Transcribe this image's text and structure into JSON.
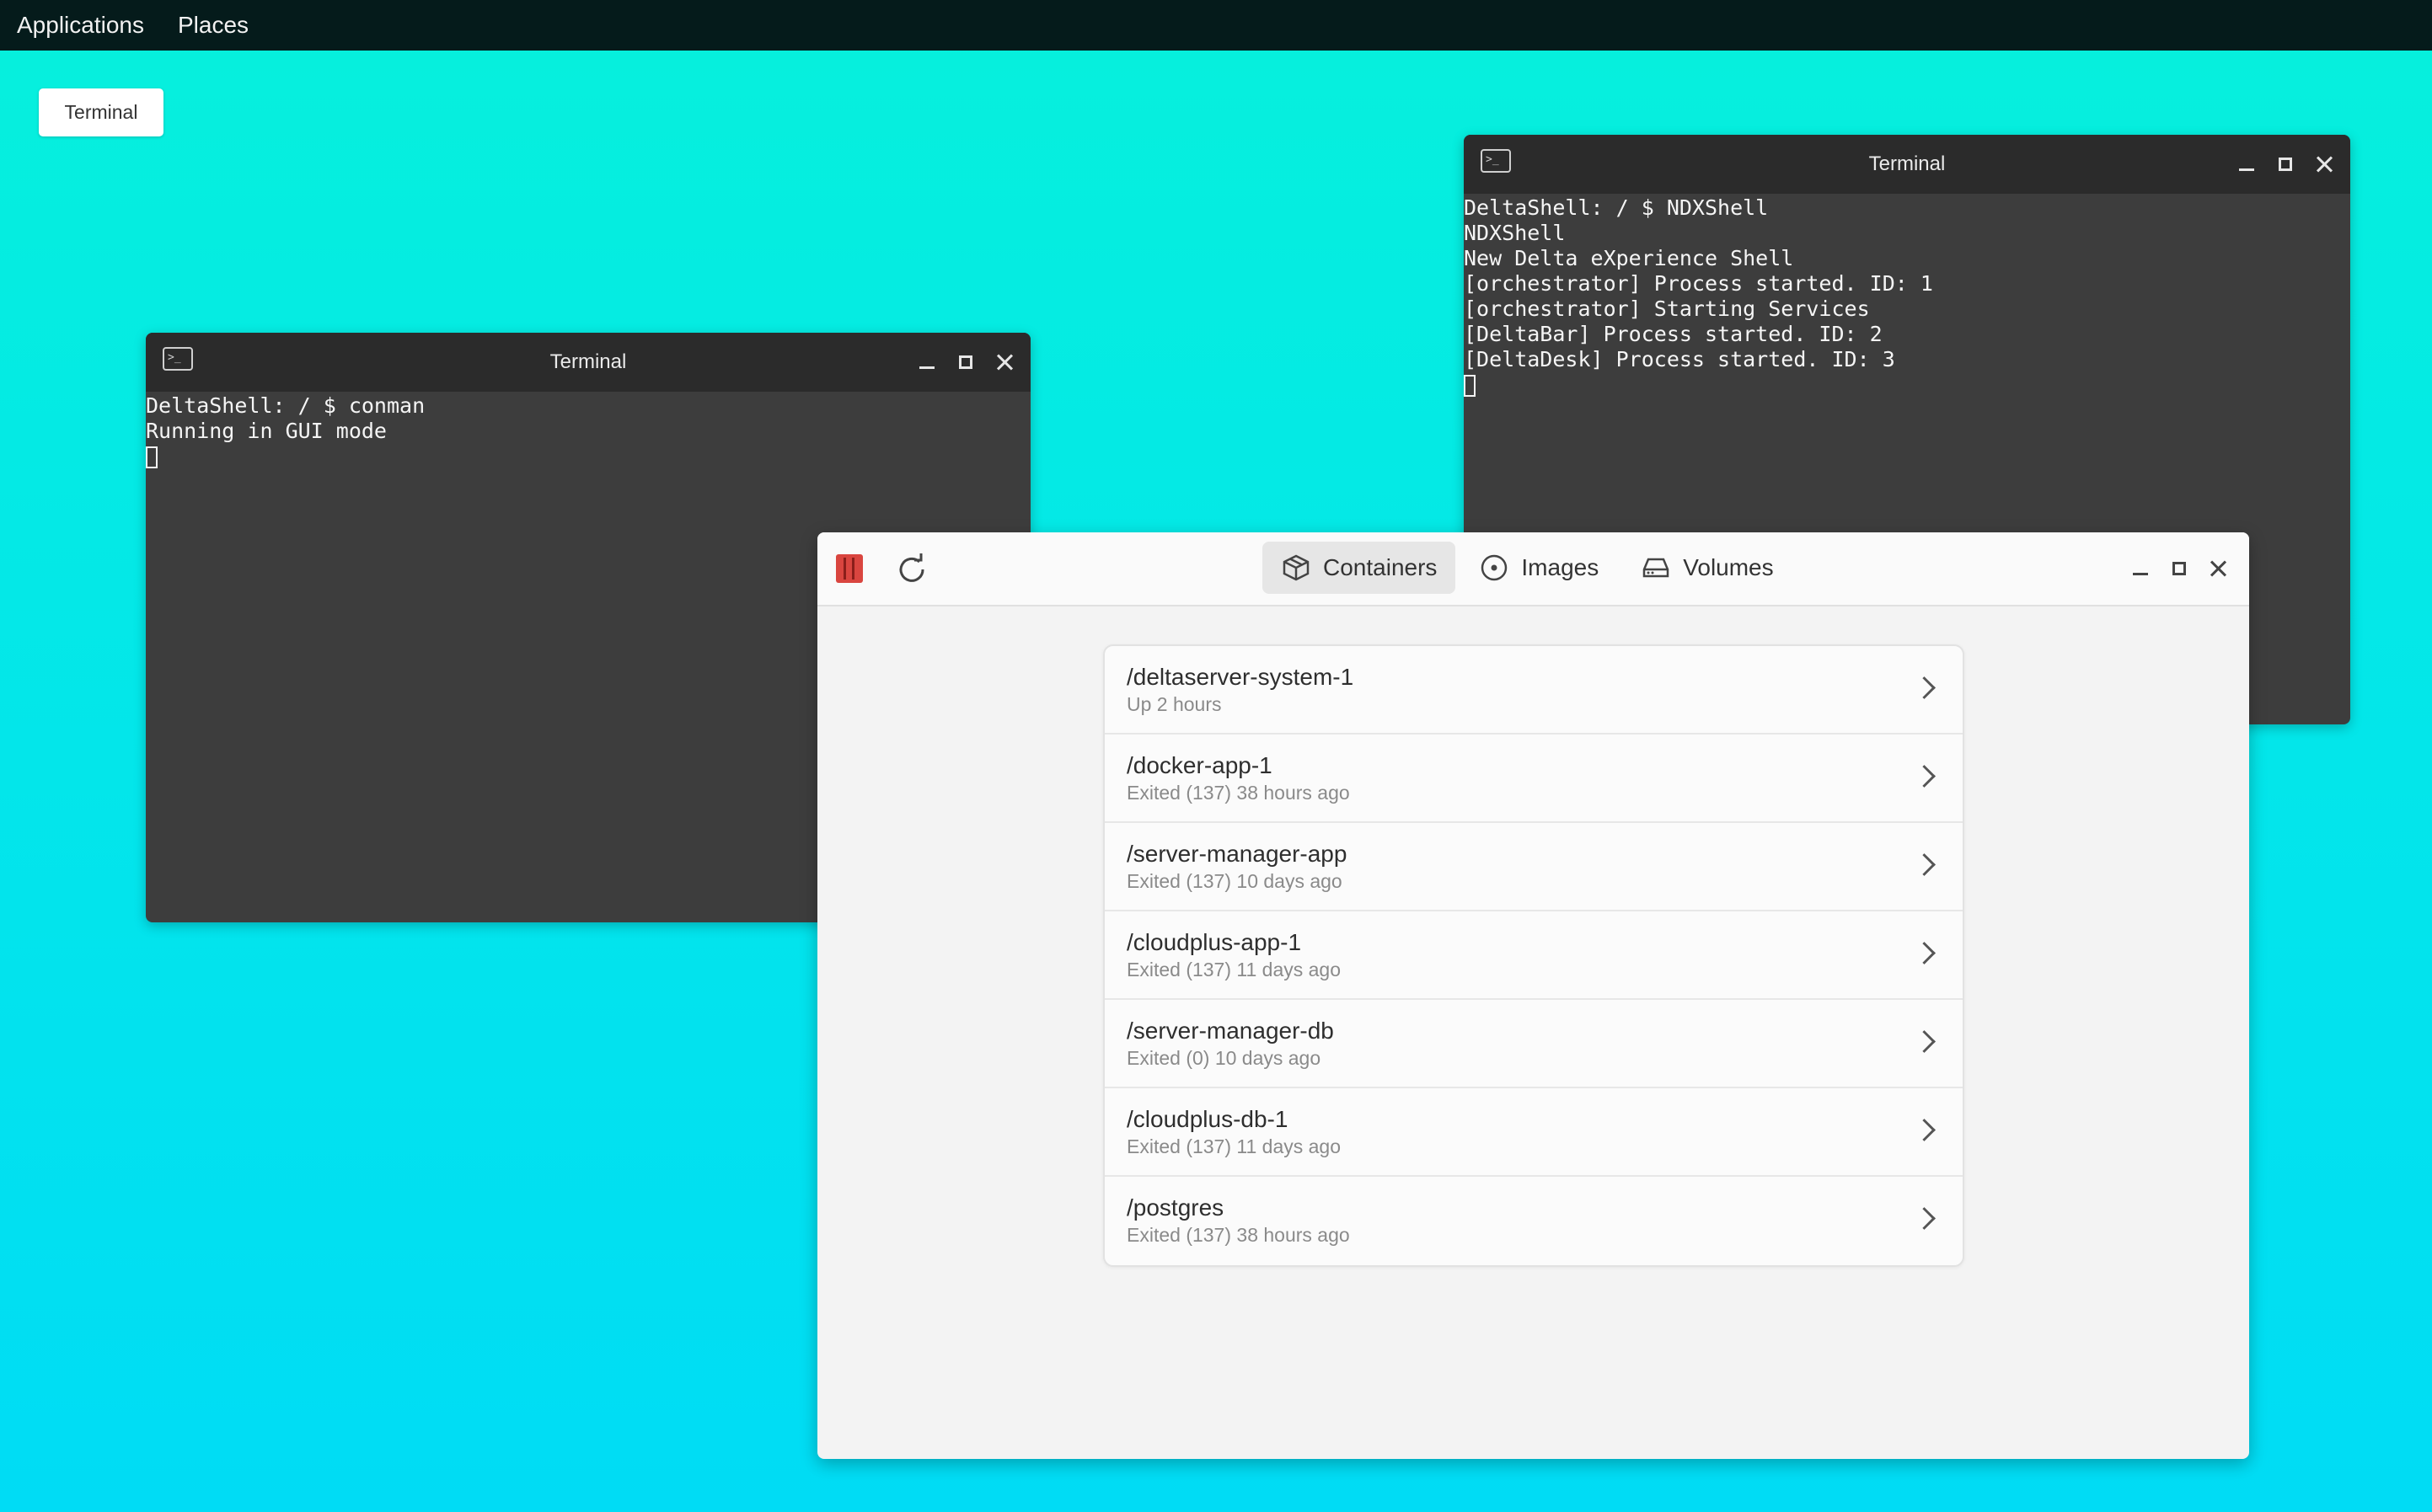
{
  "topbar": {
    "menus": [
      "Applications",
      "Places"
    ]
  },
  "taskbar": {
    "button_label": "Terminal"
  },
  "terminal_left": {
    "title": "Terminal",
    "lines": [
      "DeltaShell: / $ conman",
      "Running in GUI mode"
    ]
  },
  "terminal_right": {
    "title": "Terminal",
    "lines": [
      "DeltaShell: / $ NDXShell",
      "NDXShell",
      "New Delta eXperience Shell",
      "[orchestrator] Process started. ID: 1",
      "[orchestrator] Starting Services",
      "[DeltaBar] Process started. ID: 2",
      "[DeltaDesk] Process started. ID: 3"
    ]
  },
  "container_manager": {
    "tabs": [
      {
        "label": "Containers",
        "icon": "box-icon",
        "active": true
      },
      {
        "label": "Images",
        "icon": "disc-icon",
        "active": false
      },
      {
        "label": "Volumes",
        "icon": "drive-icon",
        "active": false
      }
    ],
    "containers": [
      {
        "name": "/deltaserver-system-1",
        "status": "Up 2 hours"
      },
      {
        "name": "/docker-app-1",
        "status": "Exited (137) 38 hours ago"
      },
      {
        "name": "/server-manager-app",
        "status": "Exited (137) 10 days ago"
      },
      {
        "name": "/cloudplus-app-1",
        "status": "Exited (137) 11 days ago"
      },
      {
        "name": "/server-manager-db",
        "status": "Exited (0) 10 days ago"
      },
      {
        "name": "/cloudplus-db-1",
        "status": "Exited (137) 11 days ago"
      },
      {
        "name": "/postgres",
        "status": "Exited (137) 38 hours ago"
      }
    ]
  },
  "colors": {
    "desktop_top": "#06f0dc",
    "desktop_bottom": "#00dcf5",
    "topbar": "#051b1b",
    "terminal_bg": "#3d3d3d",
    "terminal_title": "#2b2b2b",
    "logo_red": "#d9453f"
  }
}
